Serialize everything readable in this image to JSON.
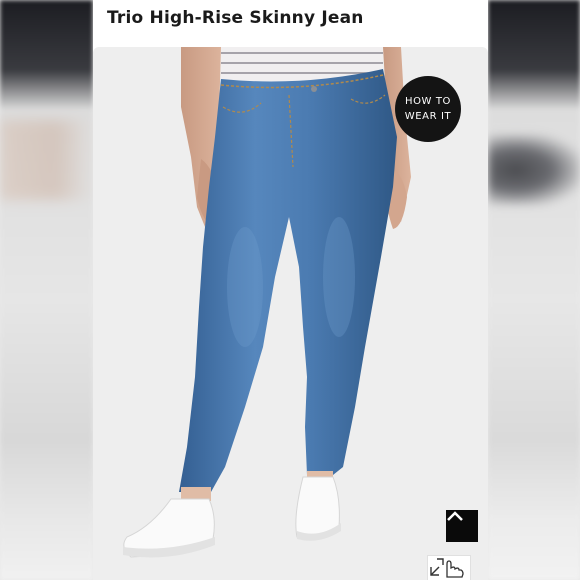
{
  "product": {
    "title": "Trio High-Rise Skinny Jean"
  },
  "badge": {
    "line1": "HOW TO",
    "line2": "WEAR IT"
  },
  "icons": {
    "scroll_top": "chevron-up-icon",
    "zoom": "expand-hand-icon",
    "badge": "how-to-wear-it-badge"
  },
  "colors": {
    "denim": "#4a78ad",
    "badge_bg": "#141414",
    "scroll_bg": "#0a0a0a"
  }
}
